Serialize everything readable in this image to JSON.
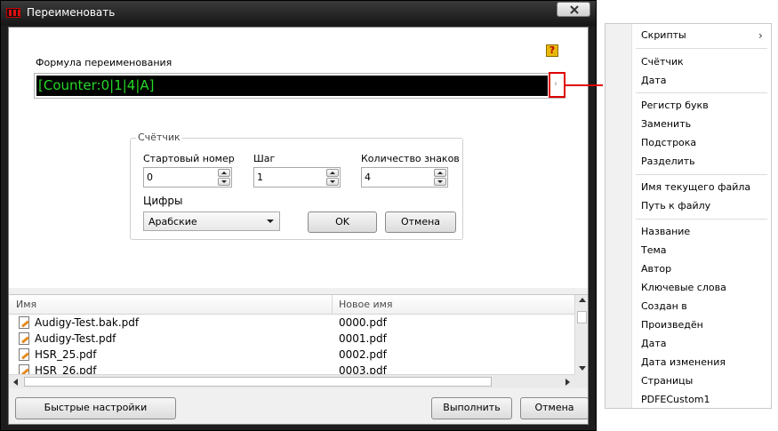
{
  "dialog": {
    "title": "Переименовать",
    "formula_label": "Формула переименования",
    "formula_value": "[Counter:0|1|4|A]",
    "help_icon": "help-icon",
    "counter_group": {
      "title": "Счётчик",
      "start_label": "Стартовый номер",
      "start_value": "0",
      "step_label": "Шаг",
      "step_value": "1",
      "digits_count_label": "Количество знаков",
      "digits_count_value": "4",
      "digits_label": "Цифры",
      "digits_value": "Арабские",
      "ok_label": "OK",
      "cancel_label": "Отмена"
    },
    "list": {
      "columns": [
        "Имя",
        "Новое имя"
      ],
      "rows": [
        {
          "name": "Audigy-Test.bak.pdf",
          "new_name": "0000.pdf"
        },
        {
          "name": "Audigy-Test.pdf",
          "new_name": "0001.pdf"
        },
        {
          "name": "HSR_25.pdf",
          "new_name": "0002.pdf"
        },
        {
          "name": "HSR_26.pdf",
          "new_name": "0003.pdf"
        }
      ]
    },
    "footer": {
      "quick_settings_label": "Быстрые настройки",
      "run_label": "Выполнить",
      "cancel_label": "Отмена"
    }
  },
  "menu": {
    "items": [
      "Скрипты",
      "Счётчик",
      "Дата",
      "Регистр букв",
      "Заменить",
      "Подстрока",
      "Разделить",
      "Имя текущего файла",
      "Путь к файлу",
      "Название",
      "Тема",
      "Автор",
      "Ключевые слова",
      "Создан в",
      "Произведён",
      "Дата",
      "Дата изменения",
      "Страницы",
      "PDFECustom1"
    ],
    "submenu_glyph": "›"
  },
  "colors": {
    "formula_text": "#27d727",
    "highlight": "#e00000",
    "help_icon": "#e7b90a"
  }
}
